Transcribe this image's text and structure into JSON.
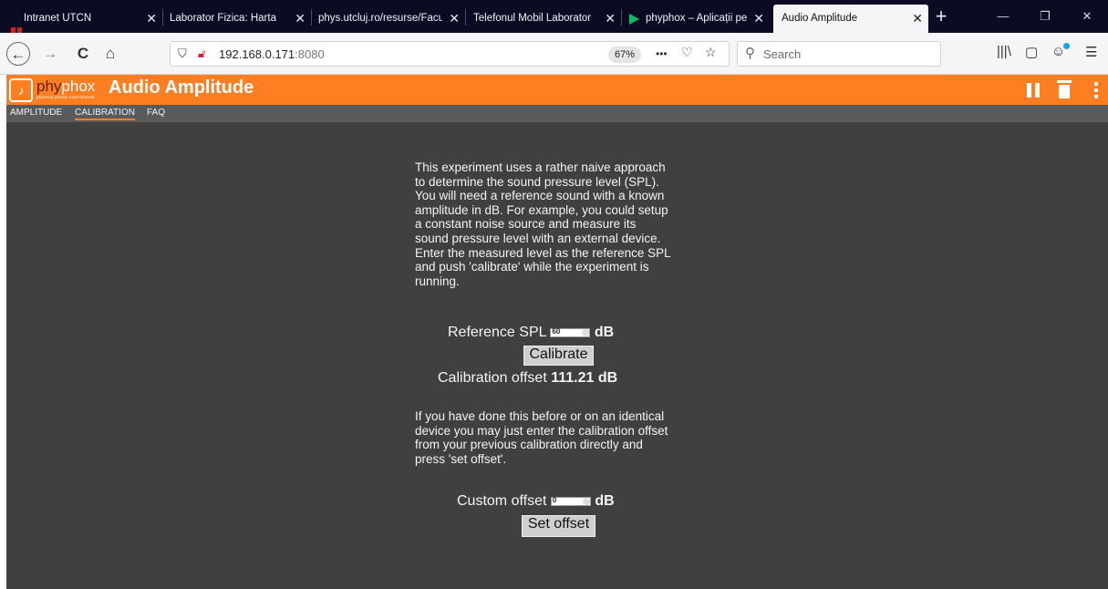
{
  "browser": {
    "tabs": [
      {
        "title": "Intranet UTCN",
        "favicon": "utcn-icon"
      },
      {
        "title": "Laborator Fizica: Harta",
        "favicon": "none"
      },
      {
        "title": "phys.utcluj.ro/resurse/Facu",
        "favicon": "none"
      },
      {
        "title": "Telefonul Mobil Laborator",
        "favicon": "none"
      },
      {
        "title": "phyphox – Aplicații pe",
        "favicon": "google-play-icon"
      },
      {
        "title": "Audio Amplitude",
        "favicon": "none",
        "active": true
      }
    ],
    "tab_close": "✕",
    "new_tab": "+",
    "window_controls": {
      "minimize": "—",
      "restore": "❐",
      "close": "✕"
    },
    "nav": {
      "back": "←",
      "forward": "→",
      "reload": "C",
      "home": "⌂"
    },
    "url": {
      "host": "192.168.0.171",
      "port": ":8080"
    },
    "zoom": "67%",
    "page_actions": "•••",
    "search_placeholder": "Search",
    "toolbar_icons": [
      "library-icon",
      "sidebar-icon",
      "account-icon",
      "menu-icon"
    ]
  },
  "app": {
    "logo_phy": "phy",
    "logo_phox": "phox",
    "logo_sub": "physical phone experiments",
    "title": "Audio Amplitude",
    "accent": "#ff7e22",
    "tabs": [
      "AMPLITUDE",
      "CALIBRATION",
      "FAQ"
    ],
    "active_tab": "CALIBRATION",
    "intro_lines": [
      "This experiment uses a rather naive approach",
      "to determine the sound pressure level (SPL).",
      "You will need a reference sound with a known",
      "amplitude in dB. For example, you could setup",
      "a constant noise source and measure its",
      "sound pressure level with an external device.",
      "Enter the measured level as the reference SPL",
      "and push 'calibrate' while the experiment is",
      "running."
    ],
    "reference_label": "Reference SPL",
    "reference_value": "60",
    "unit": "dB",
    "calibrate_label": "Calibrate",
    "offset_label": "Calibration offset",
    "offset_value": "111.21",
    "note_lines": [
      "If you have done this before or on an identical",
      "device you may just enter the calibration offset",
      "from your previous calibration directly and",
      "press 'set offset'."
    ],
    "custom_label": "Custom offset",
    "custom_value": "0",
    "set_offset_label": "Set offset"
  }
}
